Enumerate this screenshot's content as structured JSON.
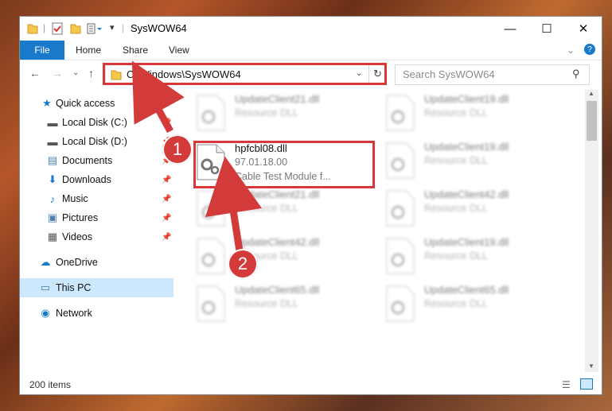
{
  "window": {
    "title": "SysWOW64"
  },
  "ribbon": {
    "file": "File",
    "home": "Home",
    "share": "Share",
    "view": "View"
  },
  "address": {
    "path": "C:\\Windows\\SysWOW64"
  },
  "search": {
    "placeholder": "Search SysWOW64"
  },
  "sidebar": {
    "items": [
      {
        "label": "Quick access",
        "icon": "star-icon"
      },
      {
        "label": "Local Disk (C:)",
        "icon": "drive-icon"
      },
      {
        "label": "Local Disk (D:)",
        "icon": "drive-icon"
      },
      {
        "label": "Documents",
        "icon": "documents-icon"
      },
      {
        "label": "Downloads",
        "icon": "download-icon"
      },
      {
        "label": "Music",
        "icon": "music-icon"
      },
      {
        "label": "Pictures",
        "icon": "pictures-icon"
      },
      {
        "label": "Videos",
        "icon": "videos-icon"
      },
      {
        "label": "OneDrive",
        "icon": "cloud-icon"
      },
      {
        "label": "This PC",
        "icon": "computer-icon"
      },
      {
        "label": "Network",
        "icon": "network-icon"
      }
    ]
  },
  "files": {
    "highlighted": {
      "name": "hpfcbl08.dll",
      "version": "97.01.18.00",
      "description": "Cable Test Module f..."
    },
    "background": [
      {
        "name": "UpdateClient21.dll",
        "type": "Resource DLL"
      },
      {
        "name": "UpdateClient19.dll",
        "type": "Resource DLL"
      },
      {
        "name": "UpdateClient19.dll",
        "type": "Resource DLL"
      },
      {
        "name": "UpdateClient21.dll",
        "type": "Resource DLL"
      },
      {
        "name": "UpdateClient42.dll",
        "type": "Resource DLL"
      },
      {
        "name": "UpdateClient42.dll",
        "type": "Resource DLL"
      },
      {
        "name": "UpdateClient19.dll",
        "type": "Resource DLL"
      },
      {
        "name": "UpdateClient65.dll",
        "type": "Resource DLL"
      },
      {
        "name": "UpdateClient65.dll",
        "type": "Resource DLL"
      }
    ]
  },
  "status": {
    "count": "200 items"
  },
  "callouts": {
    "one": "1",
    "two": "2"
  },
  "colors": {
    "accent": "#1979ca",
    "highlight": "#d9383a",
    "selected": "#cce8ff"
  }
}
